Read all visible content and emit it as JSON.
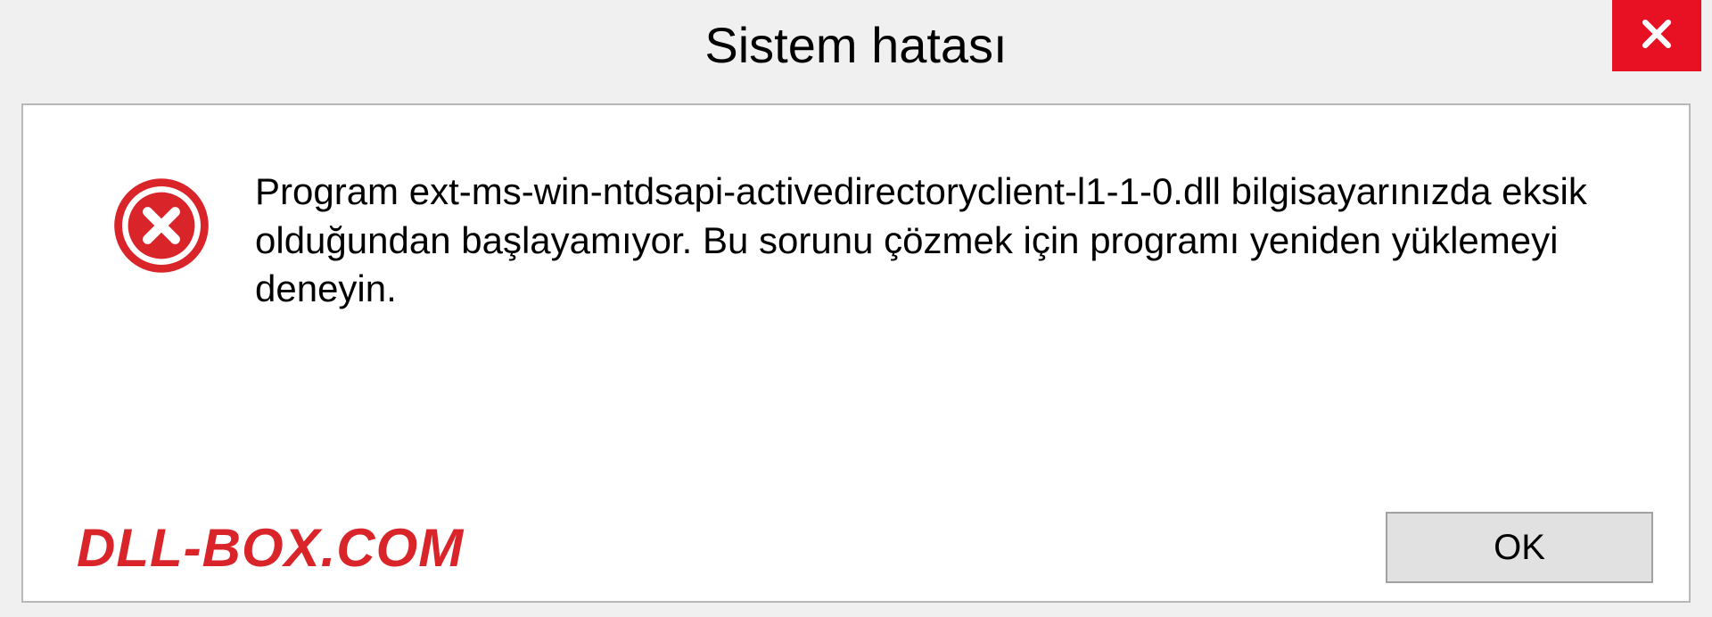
{
  "dialog": {
    "title": "Sistem hatası",
    "message": "Program ext-ms-win-ntdsapi-activedirectoryclient-l1-1-0.dll bilgisayarınızda eksik olduğundan başlayamıyor. Bu sorunu çözmek için programı yeniden yüklemeyi deneyin.",
    "ok_label": "OK",
    "watermark": "DLL-BOX.COM"
  },
  "colors": {
    "close_bg": "#e81123",
    "error_icon": "#d9252a",
    "watermark": "#d9252a"
  }
}
